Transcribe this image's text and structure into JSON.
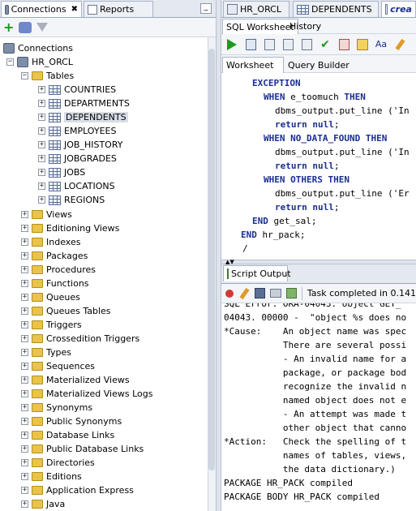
{
  "left_panel": {
    "tabs": [
      {
        "label": "Connections",
        "close": "✖"
      },
      {
        "label": "Reports"
      }
    ],
    "minimize": "_",
    "tree": {
      "connections_label": "Connections",
      "connection": "HR_ORCL",
      "tables_label": "Tables",
      "tables": [
        "COUNTRIES",
        "DEPARTMENTS",
        "DEPENDENTS",
        "EMPLOYEES",
        "JOB_HISTORY",
        "JOBGRADES",
        "JOBS",
        "LOCATIONS",
        "REGIONS"
      ],
      "selected_table": "DEPENDENTS",
      "folders": [
        "Views",
        "Editioning Views",
        "Indexes",
        "Packages",
        "Procedures",
        "Functions",
        "Queues",
        "Queues Tables",
        "Triggers",
        "Crossedition Triggers",
        "Types",
        "Sequences",
        "Materialized Views",
        "Materialized Views Logs",
        "Synonyms",
        "Public Synonyms",
        "Database Links",
        "Public Database Links",
        "Directories",
        "Editions",
        "Application Express",
        "Java"
      ]
    }
  },
  "editor": {
    "tabs": [
      {
        "label": "HR_ORCL"
      },
      {
        "label": "DEPENDENTS"
      },
      {
        "label": "crea"
      }
    ],
    "sub_tabs": [
      {
        "label": "SQL Worksheet"
      },
      {
        "label": "History"
      }
    ],
    "ws_tabs": [
      {
        "label": "Worksheet"
      },
      {
        "label": "Query Builder"
      }
    ],
    "code_lines": [
      "EXCEPTION",
      "  WHEN e_toomuch THEN",
      "    dbms_output.put_line ('In",
      "    return null;",
      "  WHEN NO_DATA_FOUND THEN",
      "    dbms_output.put_line ('In",
      "    return null;",
      "  WHEN OTHERS THEN",
      "    dbms_output.put_line ('Er",
      "    return null;",
      "END get_sal;",
      "END hr_pack;",
      "/"
    ]
  },
  "output": {
    "tab_label": "Script Output",
    "status": "Task completed in 0.141",
    "lines": [
      "SQL Error: ORA-04043: object GET_",
      "04043. 00000 -  \"object %s does no",
      "*Cause:    An object name was spec",
      "           There are several possi",
      "           - An invalid name for a",
      "           package, or package bod",
      "           recognize the invalid n",
      "           named object does not e",
      "           - An attempt was made t",
      "           other object that canno",
      "*Action:   Check the spelling of t",
      "           names of tables, views,",
      "           the data dictionary.)",
      "PACKAGE HR_PACK compiled",
      "PACKAGE BODY HR_PACK compiled"
    ]
  }
}
